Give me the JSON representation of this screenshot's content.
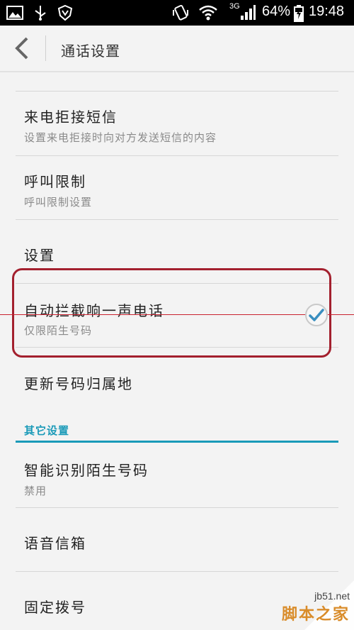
{
  "status_bar": {
    "network": "3G",
    "battery": "64%",
    "time": "19:48"
  },
  "action_bar": {
    "title": "通话设置"
  },
  "items": [
    {
      "title": "来电拒接短信",
      "subtitle": "设置来电拒接时向对方发送短信的内容"
    },
    {
      "title": "呼叫限制",
      "subtitle": "呼叫限制设置"
    },
    {
      "title": "设置"
    },
    {
      "title": "自动拦截响一声电话",
      "subtitle": "仅限陌生号码",
      "checked": true
    },
    {
      "title": "更新号码归属地"
    }
  ],
  "section": {
    "header": "其它设置",
    "accent": "#1a9ab8"
  },
  "other_items": [
    {
      "title": "智能识别陌生号码",
      "subtitle": "禁用"
    },
    {
      "title": "语音信箱"
    },
    {
      "title": "固定拨号"
    }
  ],
  "watermark": {
    "site": "jb51.net",
    "name": "脚本之家"
  },
  "colors": {
    "highlight": "#a3202e",
    "status_bar_bg": "#000000"
  }
}
